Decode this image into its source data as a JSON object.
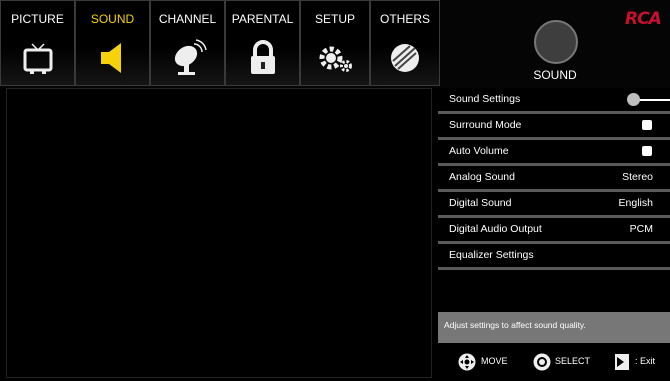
{
  "tabs": [
    {
      "label": "PICTURE",
      "icon": "tv-icon"
    },
    {
      "label": "SOUND",
      "icon": "speaker-icon",
      "active": true
    },
    {
      "label": "CHANNEL",
      "icon": "satellite-dish-icon"
    },
    {
      "label": "PARENTAL",
      "icon": "lock-icon"
    },
    {
      "label": "SETUP",
      "icon": "gear-icon"
    },
    {
      "label": "OTHERS",
      "icon": "disc-icon"
    }
  ],
  "brand": "RCA",
  "hero": {
    "title": "SOUND"
  },
  "menu": [
    {
      "label": "Sound Settings",
      "control": "slider"
    },
    {
      "label": "Surround Mode",
      "control": "checkbox"
    },
    {
      "label": "Auto Volume",
      "control": "checkbox"
    },
    {
      "label": "Analog Sound",
      "value": "Stereo"
    },
    {
      "label": "Digital Sound",
      "value": "English"
    },
    {
      "label": "Digital Audio Output",
      "value": "PCM"
    },
    {
      "label": "Equalizer Settings"
    }
  ],
  "help_text": "Adjust settings to affect sound quality.",
  "footer": {
    "move": "MOVE",
    "select": "SELECT",
    "exit": ": Exit"
  },
  "colors": {
    "active_tab": "#f5d20a",
    "brand": "#c8102e",
    "help_bg": "#777777"
  }
}
